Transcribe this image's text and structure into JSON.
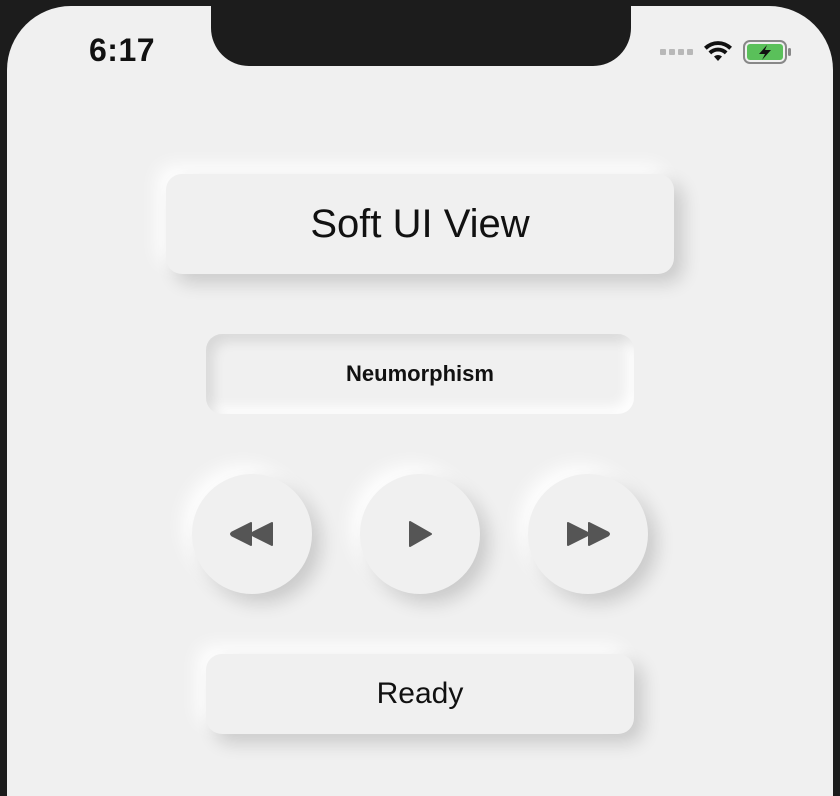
{
  "status_bar": {
    "time": "6:17",
    "signal_icon": "signal-bars-icon",
    "wifi_icon": "wifi-icon",
    "battery_icon": "battery-charging-icon",
    "battery_color": "#5ac05a"
  },
  "main": {
    "title": "Soft UI View",
    "subtitle": "Neumorphism",
    "controls": [
      {
        "name": "rewind",
        "icon": "rewind-icon"
      },
      {
        "name": "play",
        "icon": "play-icon"
      },
      {
        "name": "fast-forward",
        "icon": "fast-forward-icon"
      }
    ],
    "status": "Ready"
  },
  "colors": {
    "background": "#f0f0f0",
    "frame": "#1c1c1c",
    "icon": "#555555",
    "text": "#111111"
  }
}
